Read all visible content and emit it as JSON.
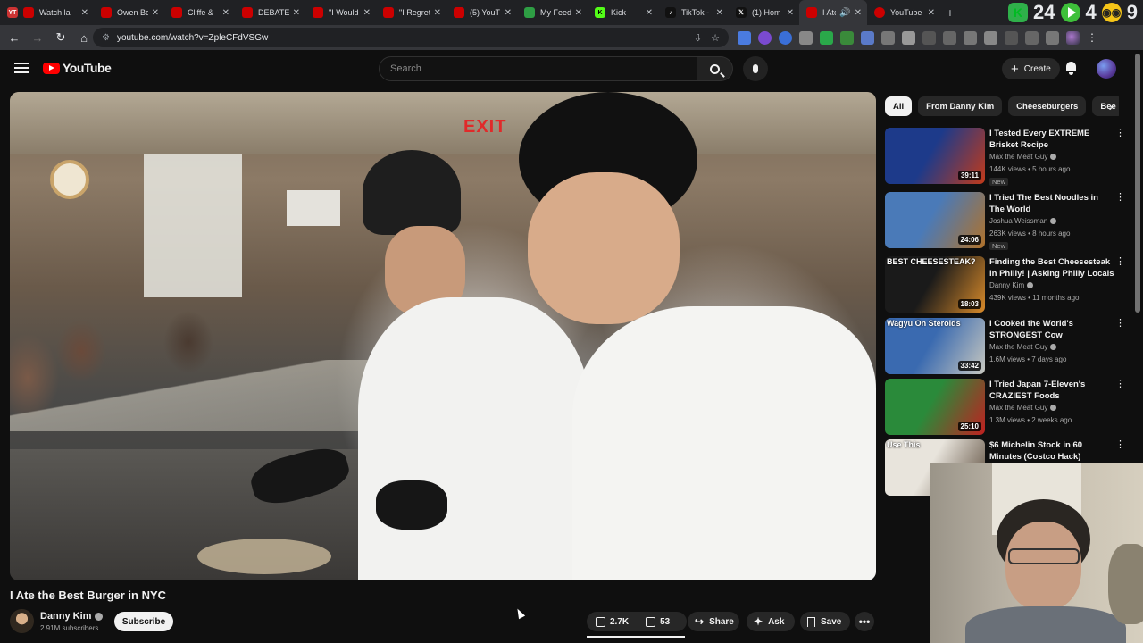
{
  "browser": {
    "tabs": [
      {
        "label": "Watch la",
        "color": "#cc0000"
      },
      {
        "label": "Owen Be",
        "color": "#cc0000"
      },
      {
        "label": "Cliffe &",
        "color": "#cc0000"
      },
      {
        "label": "DEBATE!",
        "color": "#cc0000"
      },
      {
        "label": "\"I Would",
        "color": "#cc0000"
      },
      {
        "label": "\"I Regret",
        "color": "#cc0000"
      },
      {
        "label": "(5) YouT",
        "color": "#cc0000"
      },
      {
        "label": "My Feed",
        "color": "#2e9e44"
      },
      {
        "label": "Kick",
        "color": "#53fc18"
      },
      {
        "label": "TikTok -",
        "color": "#111111"
      },
      {
        "label": "(1) Hom",
        "color": "#111111"
      },
      {
        "label": "I Ate",
        "color": "#cc0000"
      },
      {
        "label": "YouTube",
        "color": "#cc0000"
      }
    ],
    "first_tab_label": "YT",
    "url": "youtube.com/watch?v=ZpleCFdVSGw",
    "tray_number_1": "24",
    "tray_number_2": "4",
    "tray_number_3": "9"
  },
  "header": {
    "logo": "YouTube",
    "search_placeholder": "Search",
    "create_label": "Create"
  },
  "video": {
    "exit_sign": "EXIT",
    "title": "I Ate the Best Burger in NYC",
    "channel": "Danny Kim",
    "subscribers": "2.91M subscribers",
    "subscribe_label": "Subscribe",
    "likes": "2.7K",
    "dislikes": "53",
    "share_label": "Share",
    "ask_label": "Ask",
    "save_label": "Save"
  },
  "chips": [
    "All",
    "From Danny Kim",
    "Cheeseburgers",
    "Bee"
  ],
  "recommendations": [
    {
      "title": "I Tested Every EXTREME Brisket Recipe",
      "channel": "Max the Meat Guy",
      "meta": "144K views • 5 hours ago",
      "badge": "New",
      "duration": "39:11",
      "thumb_text": "",
      "c1": "#1d3a8a",
      "c2": "#c23a1a"
    },
    {
      "title": "I Tried The Best Noodles in The World",
      "channel": "Joshua Weissman",
      "meta": "263K views • 8 hours ago",
      "badge": "New",
      "duration": "24:06",
      "thumb_text": "",
      "c1": "#4a7ab8",
      "c2": "#b0722a"
    },
    {
      "title": "Finding the Best Cheesesteak in Philly! | Asking Philly Locals | ...",
      "channel": "Danny Kim",
      "meta": "439K views • 11 months ago",
      "badge": "",
      "duration": "18:03",
      "thumb_text": "BEST CHEESESTEAK?",
      "c1": "#1a1a1a",
      "c2": "#d88a2a"
    },
    {
      "title": "I Cooked the World's STRONGEST Cow",
      "channel": "Max the Meat Guy",
      "meta": "1.6M views • 7 days ago",
      "badge": "",
      "duration": "33:42",
      "thumb_text": "Wagyu On Steroids",
      "c1": "#3a6ab0",
      "c2": "#c8c8c0"
    },
    {
      "title": "I Tried Japan 7-Eleven's CRAZIEST Foods",
      "channel": "Max the Meat Guy",
      "meta": "1.3M views • 2 weeks ago",
      "badge": "",
      "duration": "25:10",
      "thumb_text": "",
      "c1": "#2a8a3a",
      "c2": "#c02020"
    },
    {
      "title": "$6 Michelin Stock in 60 Minutes (Costco Hack)",
      "channel": "",
      "meta": "",
      "badge": "",
      "duration": "",
      "thumb_text": "Use This",
      "c1": "#e8e4dc",
      "c2": "#5a4a3a"
    }
  ]
}
